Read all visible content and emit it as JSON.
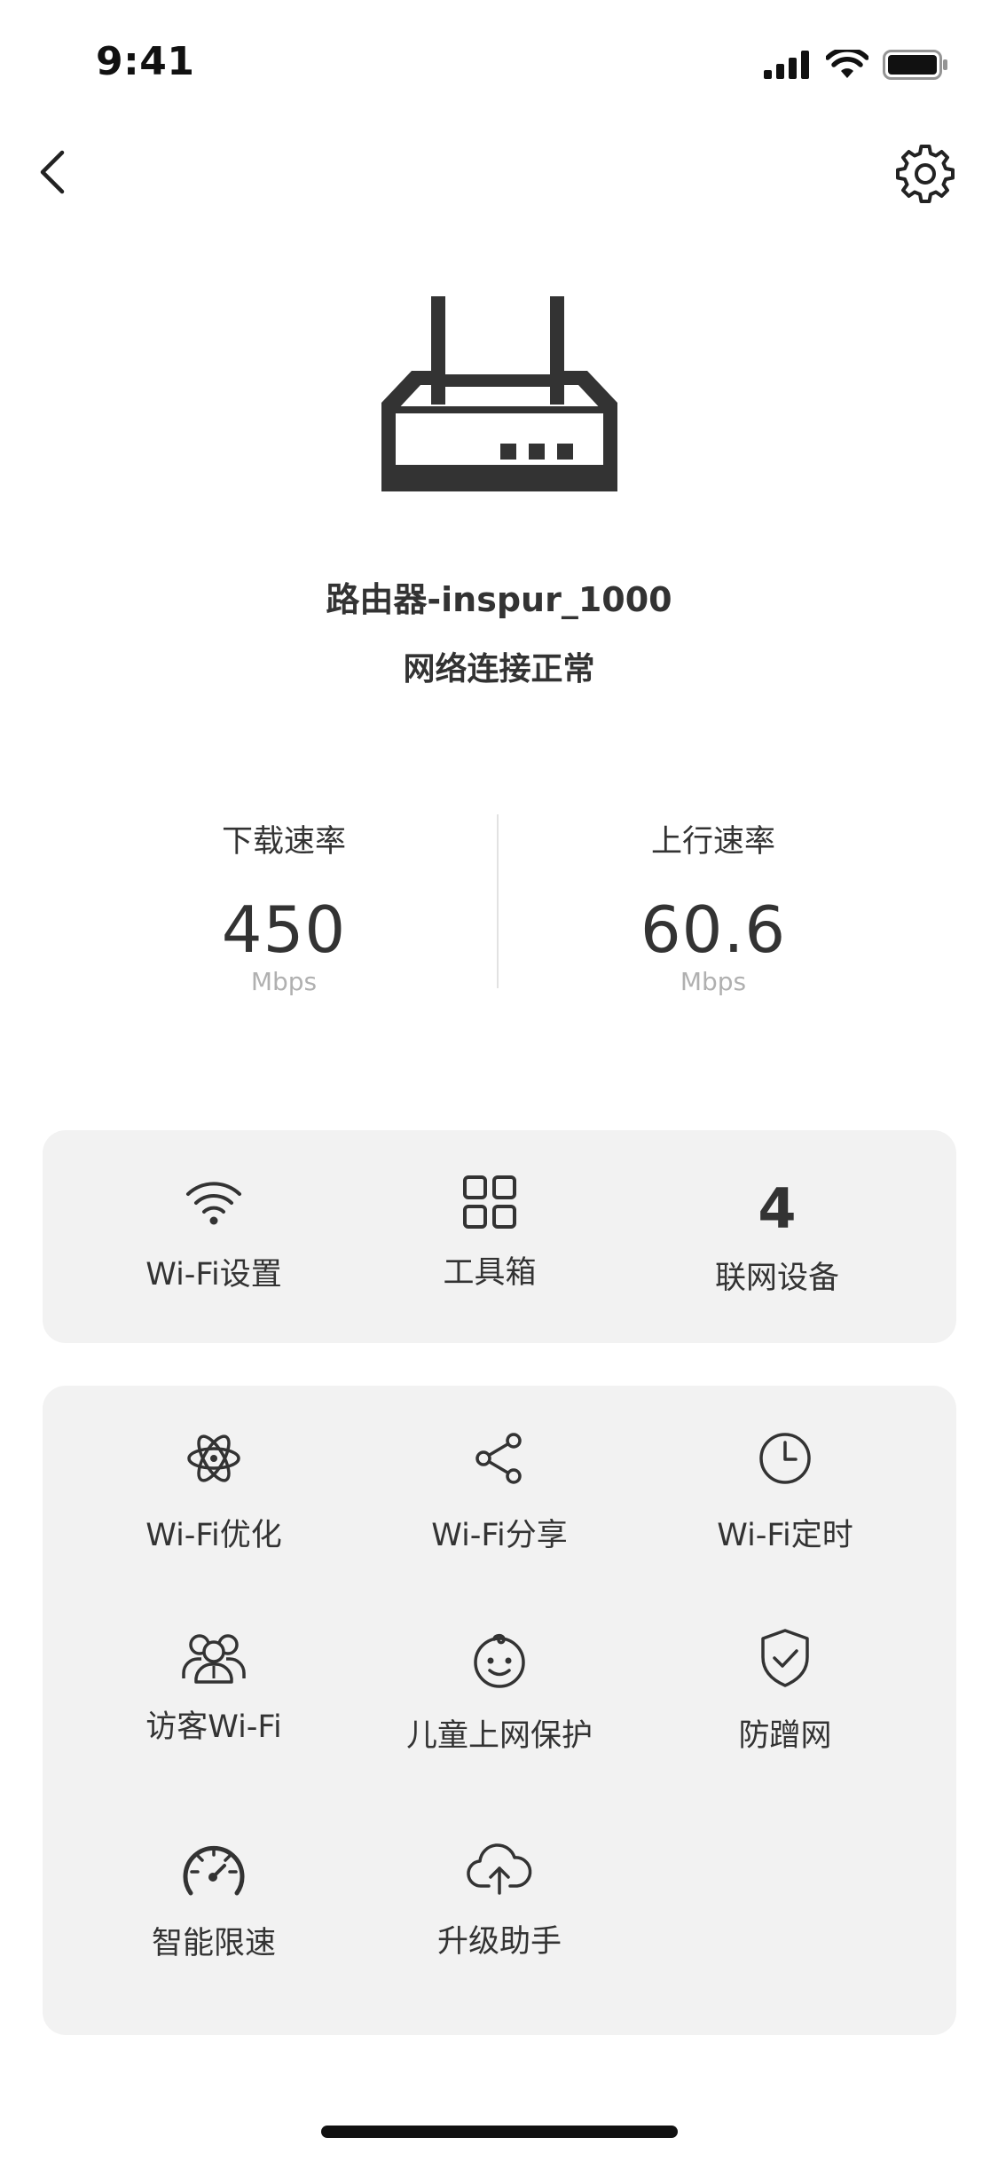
{
  "status_bar": {
    "time": "9:41"
  },
  "router": {
    "name": "路由器-inspur_1000",
    "status": "网络连接正常"
  },
  "speeds": {
    "download": {
      "title": "下载速率",
      "value": "450",
      "unit": "Mbps"
    },
    "upload": {
      "title": "上行速率",
      "value": "60.6",
      "unit": "Mbps"
    }
  },
  "top_card": {
    "wifi_settings": {
      "label": "Wi-Fi设置",
      "icon": "wifi-icon"
    },
    "toolbox": {
      "label": "工具箱",
      "icon": "grid-icon"
    },
    "devices": {
      "count": "4",
      "label": "联网设备"
    }
  },
  "features": {
    "optimize": {
      "label": "Wi-Fi优化",
      "icon": "atom-icon"
    },
    "share": {
      "label": "Wi-Fi分享",
      "icon": "share-icon"
    },
    "timer": {
      "label": "Wi-Fi定时",
      "icon": "clock-icon"
    },
    "guest": {
      "label": "访客Wi-Fi",
      "icon": "guest-icon"
    },
    "child": {
      "label": "儿童上网保护",
      "icon": "baby-face-icon"
    },
    "anti_freeload": {
      "label": "防蹭网",
      "icon": "shield-check-icon"
    },
    "speed_limit": {
      "label": "智能限速",
      "icon": "speedometer-icon"
    },
    "upgrade": {
      "label": "升级助手",
      "icon": "cloud-upload-icon"
    }
  },
  "colors": {
    "text": "#333333",
    "card_bg": "#f2f2f2",
    "muted": "#b0b0b0"
  }
}
